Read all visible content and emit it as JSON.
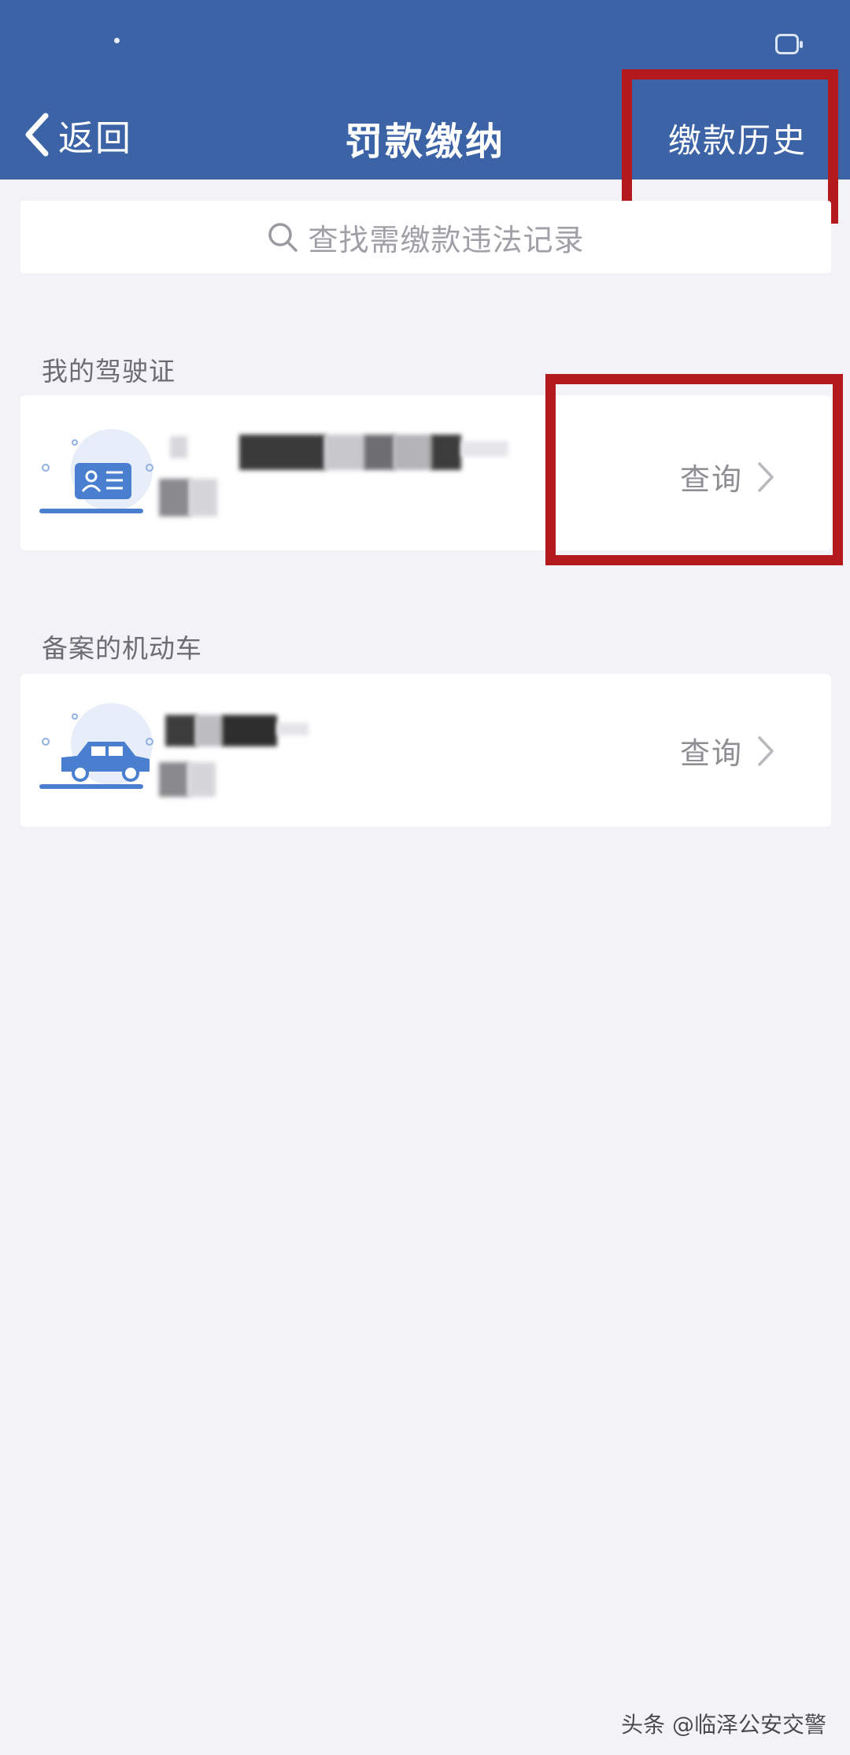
{
  "header": {
    "back_label": "返回",
    "title": "罚款缴纳",
    "history_label": "缴款历史"
  },
  "search": {
    "placeholder": "查找需缴款违法记录",
    "icon": "search-icon"
  },
  "sections": [
    {
      "title": "我的驾驶证",
      "card": {
        "icon": "license-card-icon",
        "action_label": "查询",
        "action_icon": "chevron-right-icon"
      }
    },
    {
      "title": "备案的机动车",
      "card": {
        "icon": "car-icon",
        "action_label": "查询",
        "action_icon": "chevron-right-icon"
      }
    }
  ],
  "watermark": "头条 @临泽公安交警",
  "colors": {
    "header_bg": "#3b63a6",
    "page_bg": "#f3f2f7",
    "annotation": "#b3191d",
    "icon_blue": "#4a7fcf"
  }
}
